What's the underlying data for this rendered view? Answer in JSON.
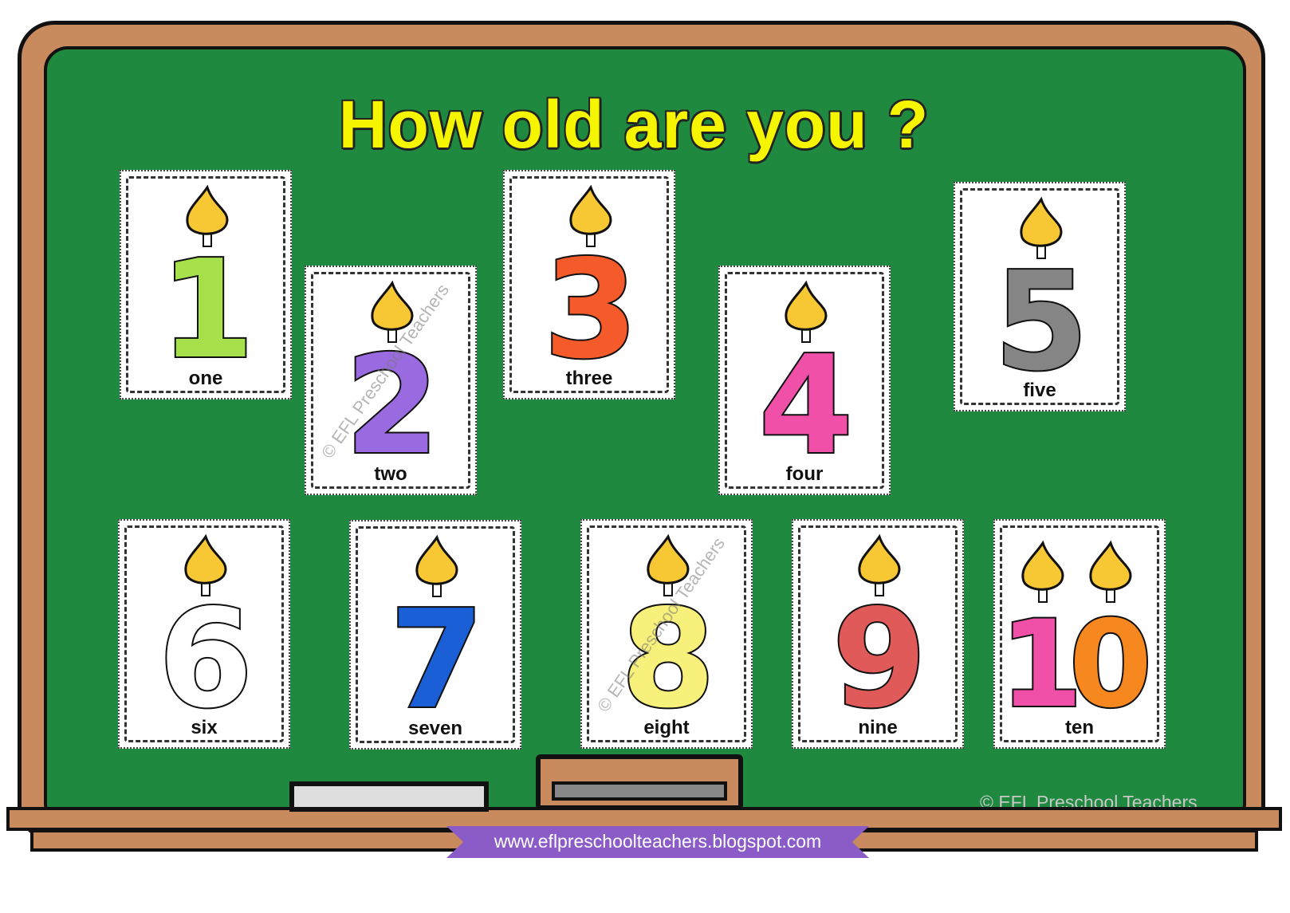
{
  "title": "How old are you ?",
  "cards": [
    {
      "number": "1",
      "word": "one",
      "color": "#a6e04a"
    },
    {
      "number": "2",
      "word": "two",
      "color": "#9a6be0"
    },
    {
      "number": "3",
      "word": "three",
      "color": "#f45a2a"
    },
    {
      "number": "4",
      "word": "four",
      "color": "#f050a8"
    },
    {
      "number": "5",
      "word": "five",
      "color": "#858585"
    },
    {
      "number": "6",
      "word": "six",
      "color": "#ffffff"
    },
    {
      "number": "7",
      "word": "seven",
      "color": "#1a5fd6"
    },
    {
      "number": "8",
      "word": "eight",
      "color": "#f7f07a"
    },
    {
      "number": "9",
      "word": "nine",
      "color": "#e05a5a"
    },
    {
      "number": "10",
      "word": "ten",
      "color": "#f050a8",
      "color2": "#f7871f"
    }
  ],
  "watermark": "© EFL Preschool Teachers",
  "copyright": "© EFL Preschool Teachers",
  "url": "www.eflpreschoolteachers.blogspot.com",
  "colors": {
    "board": "#1f8a3f",
    "frame": "#c98a5e",
    "title": "#f5f500",
    "flame": "#f7c833"
  }
}
